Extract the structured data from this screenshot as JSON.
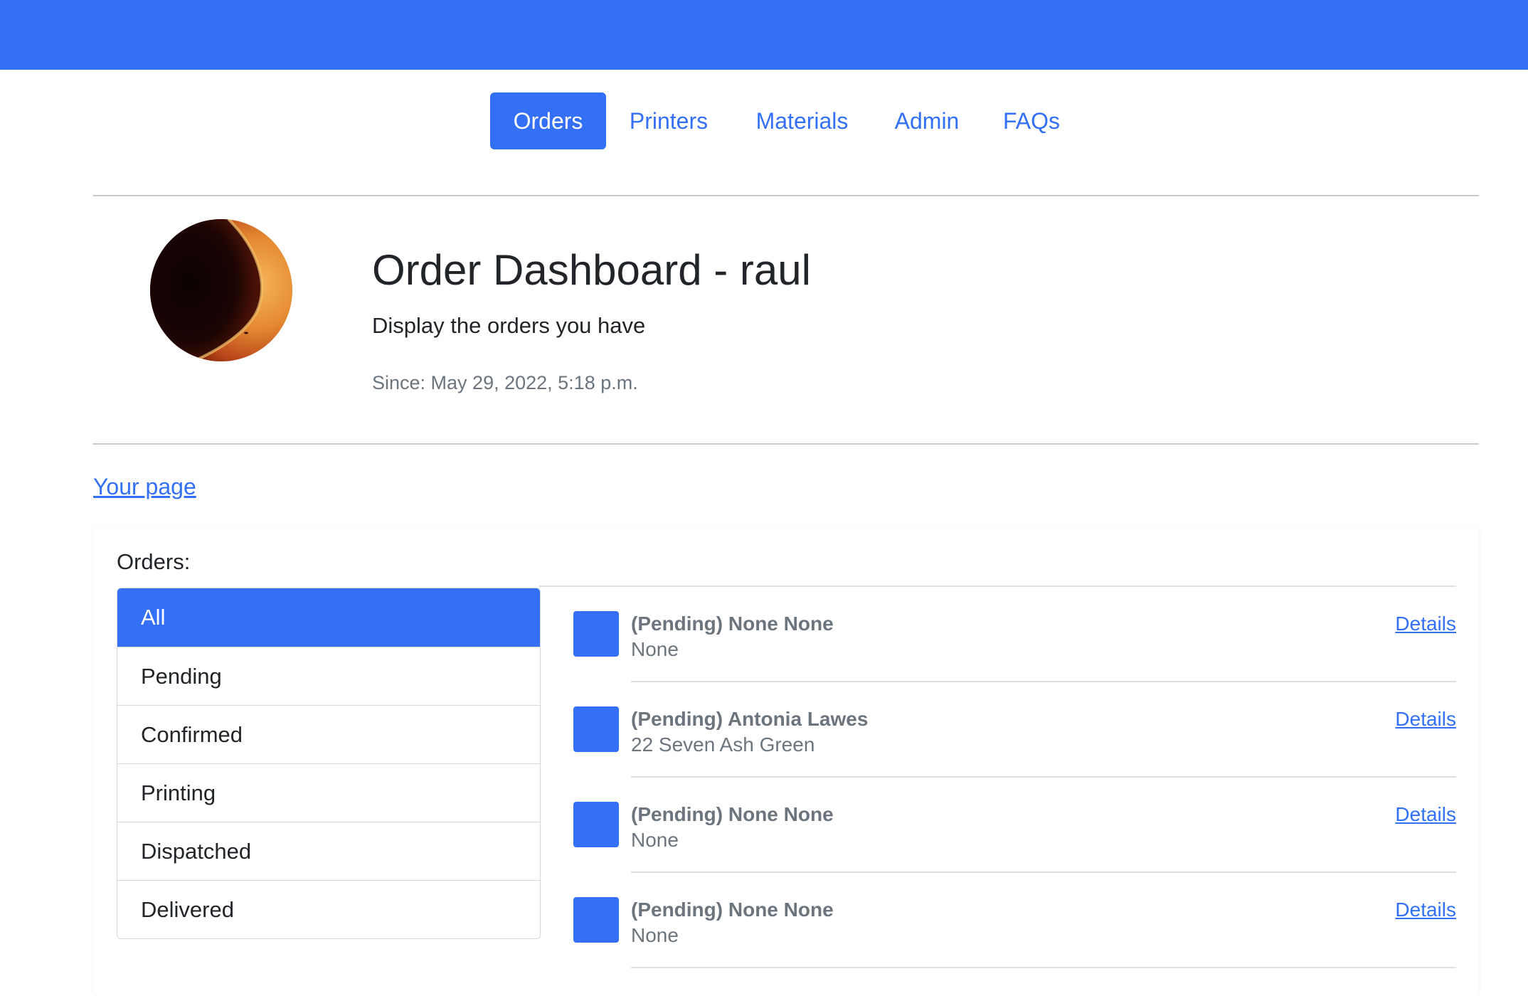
{
  "nav": {
    "items": [
      {
        "label": "Orders",
        "active": true
      },
      {
        "label": "Printers",
        "active": false
      },
      {
        "label": "Materials",
        "active": false
      },
      {
        "label": "Admin",
        "active": false
      },
      {
        "label": "FAQs",
        "active": false
      }
    ]
  },
  "header": {
    "title": "Order Dashboard - raul",
    "subtitle": "Display the orders you have",
    "since": "Since: May 29, 2022, 5:18 p.m."
  },
  "links": {
    "your_page": "Your page"
  },
  "orders": {
    "label": "Orders:",
    "statuses": [
      {
        "label": "All",
        "active": true
      },
      {
        "label": "Pending",
        "active": false
      },
      {
        "label": "Confirmed",
        "active": false
      },
      {
        "label": "Printing",
        "active": false
      },
      {
        "label": "Dispatched",
        "active": false
      },
      {
        "label": "Delivered",
        "active": false
      }
    ],
    "list": [
      {
        "name": "(Pending) None None",
        "address": "None",
        "action": "Details"
      },
      {
        "name": "(Pending) Antonia Lawes",
        "address": "22 Seven Ash Green",
        "action": "Details"
      },
      {
        "name": "(Pending) None None",
        "address": "None",
        "action": "Details"
      },
      {
        "name": "(Pending) None None",
        "address": "None",
        "action": "Details"
      }
    ]
  },
  "colors": {
    "primary": "#3470f5",
    "muted": "#6c757d",
    "text": "#212529"
  }
}
